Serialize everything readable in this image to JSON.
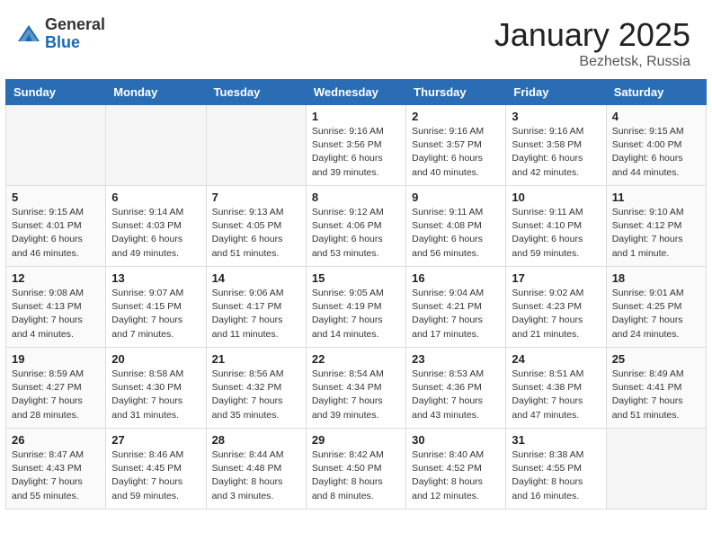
{
  "header": {
    "logo_general": "General",
    "logo_blue": "Blue",
    "month_title": "January 2025",
    "location": "Bezhetsk, Russia"
  },
  "days_of_week": [
    "Sunday",
    "Monday",
    "Tuesday",
    "Wednesday",
    "Thursday",
    "Friday",
    "Saturday"
  ],
  "weeks": [
    [
      {
        "day": "",
        "info": ""
      },
      {
        "day": "",
        "info": ""
      },
      {
        "day": "",
        "info": ""
      },
      {
        "day": "1",
        "info": "Sunrise: 9:16 AM\nSunset: 3:56 PM\nDaylight: 6 hours\nand 39 minutes."
      },
      {
        "day": "2",
        "info": "Sunrise: 9:16 AM\nSunset: 3:57 PM\nDaylight: 6 hours\nand 40 minutes."
      },
      {
        "day": "3",
        "info": "Sunrise: 9:16 AM\nSunset: 3:58 PM\nDaylight: 6 hours\nand 42 minutes."
      },
      {
        "day": "4",
        "info": "Sunrise: 9:15 AM\nSunset: 4:00 PM\nDaylight: 6 hours\nand 44 minutes."
      }
    ],
    [
      {
        "day": "5",
        "info": "Sunrise: 9:15 AM\nSunset: 4:01 PM\nDaylight: 6 hours\nand 46 minutes."
      },
      {
        "day": "6",
        "info": "Sunrise: 9:14 AM\nSunset: 4:03 PM\nDaylight: 6 hours\nand 49 minutes."
      },
      {
        "day": "7",
        "info": "Sunrise: 9:13 AM\nSunset: 4:05 PM\nDaylight: 6 hours\nand 51 minutes."
      },
      {
        "day": "8",
        "info": "Sunrise: 9:12 AM\nSunset: 4:06 PM\nDaylight: 6 hours\nand 53 minutes."
      },
      {
        "day": "9",
        "info": "Sunrise: 9:11 AM\nSunset: 4:08 PM\nDaylight: 6 hours\nand 56 minutes."
      },
      {
        "day": "10",
        "info": "Sunrise: 9:11 AM\nSunset: 4:10 PM\nDaylight: 6 hours\nand 59 minutes."
      },
      {
        "day": "11",
        "info": "Sunrise: 9:10 AM\nSunset: 4:12 PM\nDaylight: 7 hours\nand 1 minute."
      }
    ],
    [
      {
        "day": "12",
        "info": "Sunrise: 9:08 AM\nSunset: 4:13 PM\nDaylight: 7 hours\nand 4 minutes."
      },
      {
        "day": "13",
        "info": "Sunrise: 9:07 AM\nSunset: 4:15 PM\nDaylight: 7 hours\nand 7 minutes."
      },
      {
        "day": "14",
        "info": "Sunrise: 9:06 AM\nSunset: 4:17 PM\nDaylight: 7 hours\nand 11 minutes."
      },
      {
        "day": "15",
        "info": "Sunrise: 9:05 AM\nSunset: 4:19 PM\nDaylight: 7 hours\nand 14 minutes."
      },
      {
        "day": "16",
        "info": "Sunrise: 9:04 AM\nSunset: 4:21 PM\nDaylight: 7 hours\nand 17 minutes."
      },
      {
        "day": "17",
        "info": "Sunrise: 9:02 AM\nSunset: 4:23 PM\nDaylight: 7 hours\nand 21 minutes."
      },
      {
        "day": "18",
        "info": "Sunrise: 9:01 AM\nSunset: 4:25 PM\nDaylight: 7 hours\nand 24 minutes."
      }
    ],
    [
      {
        "day": "19",
        "info": "Sunrise: 8:59 AM\nSunset: 4:27 PM\nDaylight: 7 hours\nand 28 minutes."
      },
      {
        "day": "20",
        "info": "Sunrise: 8:58 AM\nSunset: 4:30 PM\nDaylight: 7 hours\nand 31 minutes."
      },
      {
        "day": "21",
        "info": "Sunrise: 8:56 AM\nSunset: 4:32 PM\nDaylight: 7 hours\nand 35 minutes."
      },
      {
        "day": "22",
        "info": "Sunrise: 8:54 AM\nSunset: 4:34 PM\nDaylight: 7 hours\nand 39 minutes."
      },
      {
        "day": "23",
        "info": "Sunrise: 8:53 AM\nSunset: 4:36 PM\nDaylight: 7 hours\nand 43 minutes."
      },
      {
        "day": "24",
        "info": "Sunrise: 8:51 AM\nSunset: 4:38 PM\nDaylight: 7 hours\nand 47 minutes."
      },
      {
        "day": "25",
        "info": "Sunrise: 8:49 AM\nSunset: 4:41 PM\nDaylight: 7 hours\nand 51 minutes."
      }
    ],
    [
      {
        "day": "26",
        "info": "Sunrise: 8:47 AM\nSunset: 4:43 PM\nDaylight: 7 hours\nand 55 minutes."
      },
      {
        "day": "27",
        "info": "Sunrise: 8:46 AM\nSunset: 4:45 PM\nDaylight: 7 hours\nand 59 minutes."
      },
      {
        "day": "28",
        "info": "Sunrise: 8:44 AM\nSunset: 4:48 PM\nDaylight: 8 hours\nand 3 minutes."
      },
      {
        "day": "29",
        "info": "Sunrise: 8:42 AM\nSunset: 4:50 PM\nDaylight: 8 hours\nand 8 minutes."
      },
      {
        "day": "30",
        "info": "Sunrise: 8:40 AM\nSunset: 4:52 PM\nDaylight: 8 hours\nand 12 minutes."
      },
      {
        "day": "31",
        "info": "Sunrise: 8:38 AM\nSunset: 4:55 PM\nDaylight: 8 hours\nand 16 minutes."
      },
      {
        "day": "",
        "info": ""
      }
    ]
  ]
}
